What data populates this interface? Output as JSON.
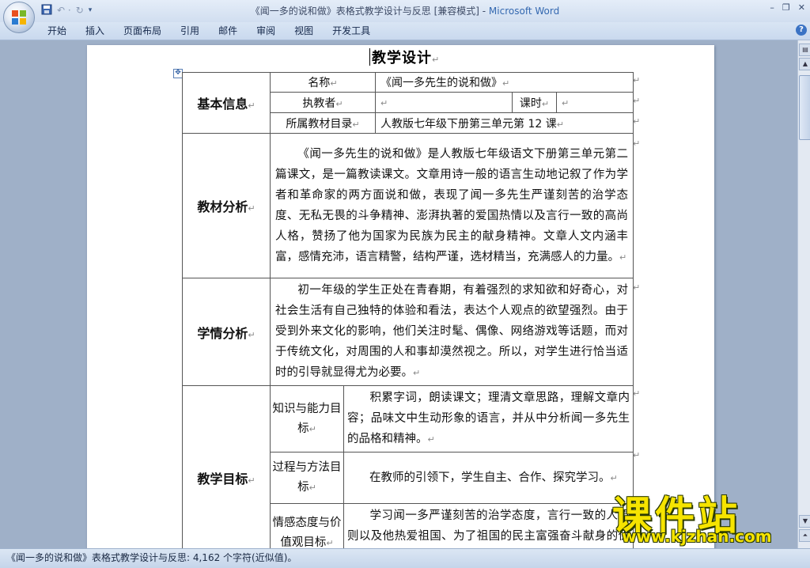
{
  "window": {
    "title_doc": "《闻一多的说和做》表格式教学设计与反思 [兼容模式] - ",
    "title_app": "Microsoft Word",
    "minimize": "–",
    "restore": "❐",
    "close": "✕"
  },
  "qat": {
    "save": "💾",
    "undo": "↶ ·",
    "redo": "↻",
    "customize": "▾"
  },
  "ribbon": {
    "tabs": [
      "开始",
      "插入",
      "页面布局",
      "引用",
      "邮件",
      "审阅",
      "视图",
      "开发工具"
    ],
    "help": "?"
  },
  "document": {
    "title": "教学设计",
    "table": {
      "basic_info": {
        "section": "基本信息",
        "name_label": "名称",
        "name_value": "《闻一多先生的说和做》",
        "teacher_label": "执教者",
        "teacher_value": "",
        "period_label": "课时",
        "period_value": "",
        "catalog_label": "所属教材目录",
        "catalog_value": "人教版七年级下册第三单元第 12 课"
      },
      "material_analysis": {
        "section": "教材分析",
        "text": "《闻一多先生的说和做》是人教版七年级语文下册第三单元第二篇课文，是一篇教读课文。文章用诗一般的语言生动地记叙了作为学者和革命家的两方面说和做，表现了闻一多先生严谨刻苦的治学态度、无私无畏的斗争精神、澎湃执著的爱国热情以及言行一致的高尚人格，赞扬了他为国家为民族为民主的献身精神。文章人文内涵丰富，感情充沛，语言精警，结构严谨，选材精当，充满感人的力量。"
      },
      "student_analysis": {
        "section": "学情分析",
        "text": "初一年级的学生正处在青春期，有着强烈的求知欲和好奇心，对社会生活有自己独特的体验和看法，表达个人观点的欲望强烈。由于受到外来文化的影响，他们关注时髦、偶像、网络游戏等话题，而对于传统文化，对周围的人和事却漠然视之。所以，对学生进行恰当适时的引导就显得尤为必要。"
      },
      "teaching_goals": {
        "section": "教学目标",
        "knowledge_label": "知识与能力目标",
        "knowledge_text": "积累字词，朗读课文；理清文章思路，理解文章内容；品味文中生动形象的语言，并从中分析闻一多先生的品格和精神。",
        "process_label": "过程与方法目标",
        "process_text": "在教师的引领下，学生自主、合作、探究学习。",
        "emotion_label": "情感态度与价值观目标",
        "emotion_text": "学习闻一多严谨刻苦的治学态度，言行一致的人原则以及他热爱祖国、为了祖国的民主富强奋斗献身的优秀品质。"
      }
    }
  },
  "statusbar": {
    "text": "《闻一多的说和做》表格式教学设计与反思: 4,162 个字符(近似值)。"
  },
  "watermark": {
    "cn": "课件站",
    "url": "www.kjzhan.com"
  }
}
